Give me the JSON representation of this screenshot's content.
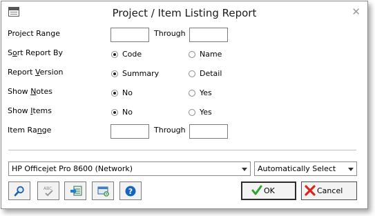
{
  "window": {
    "title": "Project / Item Listing Report",
    "close_glyph": "✕"
  },
  "form": {
    "project_range": {
      "label": "Project Range",
      "from_value": "",
      "through_label": "Through",
      "through_value": ""
    },
    "sort_report_by": {
      "label_pre": "S",
      "label_ul": "o",
      "label_post": "rt Report By",
      "options": [
        {
          "label": "Code",
          "selected": true
        },
        {
          "label": "Name",
          "selected": false
        }
      ]
    },
    "report_version": {
      "label_pre": "Report ",
      "label_ul": "V",
      "label_post": "ersion",
      "options": [
        {
          "label": "Summary",
          "selected": true
        },
        {
          "label": "Detail",
          "selected": false
        }
      ]
    },
    "show_notes": {
      "label_pre": "Show ",
      "label_ul": "N",
      "label_post": "otes",
      "options": [
        {
          "label": "No",
          "selected": true
        },
        {
          "label": "Yes",
          "selected": false
        }
      ]
    },
    "show_items": {
      "label_pre": "Show ",
      "label_ul": "I",
      "label_post": "tems",
      "options": [
        {
          "label": "No",
          "selected": true
        },
        {
          "label": "Yes",
          "selected": false
        }
      ]
    },
    "item_range": {
      "label_pre": "Item Ra",
      "label_ul": "n",
      "label_post": "ge",
      "from_value": "",
      "through_label": "Through",
      "through_value": ""
    }
  },
  "printer": {
    "selected": "HP Officejet Pro 8600 (Network)",
    "tray": "Automatically Select"
  },
  "toolbar": {
    "icons": [
      "search-icon",
      "spell-check-icon",
      "export-icon",
      "printer-settings-icon",
      "help-icon"
    ],
    "help_glyph": "?",
    "abc_text": "ABC"
  },
  "buttons": {
    "ok_label": "OK",
    "cancel_label": "Cancel"
  },
  "colors": {
    "ok_check": "#2aa42a",
    "cancel_x": "#d9261c",
    "help_blue": "#1565c0",
    "search_blue": "#1f5fa8"
  }
}
